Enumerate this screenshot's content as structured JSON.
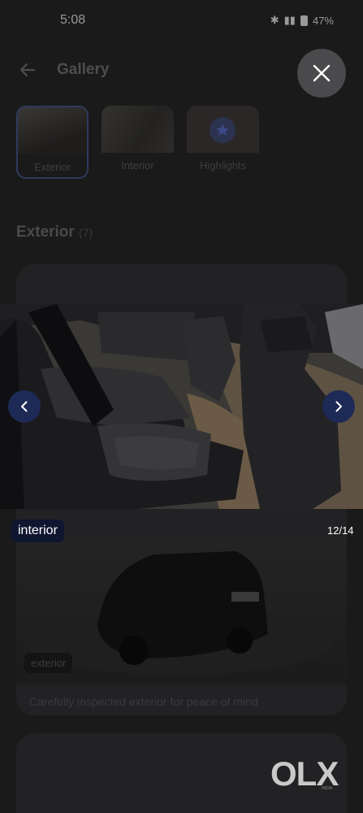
{
  "status_bar": {
    "time": "5:08",
    "battery": "47%"
  },
  "header": {
    "title": "Gallery"
  },
  "tabs": [
    {
      "label": "Exterior",
      "active": true
    },
    {
      "label": "Interior",
      "active": false
    },
    {
      "label": "Highlights",
      "active": false
    }
  ],
  "section": {
    "title": "Exterior",
    "count": "(7)"
  },
  "viewer": {
    "label": "interior",
    "counter": "12/14"
  },
  "card": {
    "badge": "exterior",
    "caption": "Carefully inspected exterior for peace of mind"
  },
  "brand": {
    "logo": "OLX",
    "sub": "INDIA"
  },
  "colors": {
    "accent": "#1d2a55",
    "background": "#1a1a1b"
  }
}
